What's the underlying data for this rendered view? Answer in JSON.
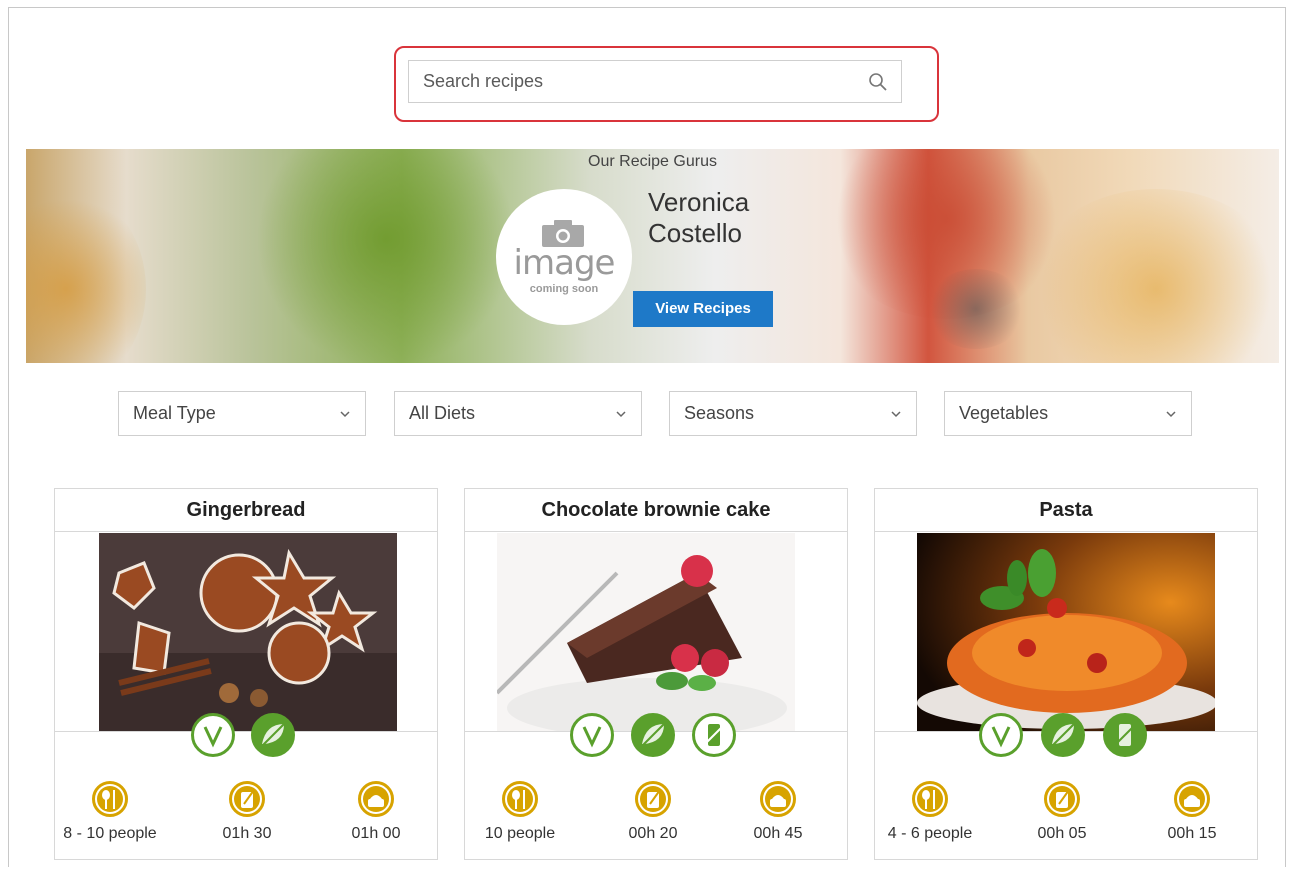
{
  "search": {
    "placeholder": "Search recipes",
    "highlight_color": "#d9343b"
  },
  "hero": {
    "title": "Our Recipe Gurus",
    "guru_name": "Veronica Costello",
    "avatar_text": "image",
    "avatar_subtext": "coming soon",
    "button_label": "View Recipes",
    "button_color": "#1e79c8"
  },
  "filters": [
    {
      "label": "Meal Type"
    },
    {
      "label": "All Diets"
    },
    {
      "label": "Seasons"
    },
    {
      "label": "Vegetables"
    }
  ],
  "recipes": [
    {
      "title": "Gingerbread",
      "diet_icons": [
        "vegetarian-icon",
        "vegan-icon"
      ],
      "servings": "8 - 10 people",
      "prep_time": "01h 30",
      "cook_time": "01h 00"
    },
    {
      "title": "Chocolate brownie cake",
      "diet_icons": [
        "vegetarian-icon",
        "vegan-icon",
        "no-preservatives-icon"
      ],
      "servings": "10 people",
      "prep_time": "00h 20",
      "cook_time": "00h 45"
    },
    {
      "title": "Pasta",
      "diet_icons": [
        "vegetarian-icon",
        "vegan-icon",
        "no-preservatives-icon"
      ],
      "servings": "4 - 6 people",
      "prep_time": "00h 05",
      "cook_time": "00h 15"
    }
  ],
  "colors": {
    "diet_green": "#5aa02c",
    "stat_gold": "#d7a300"
  }
}
